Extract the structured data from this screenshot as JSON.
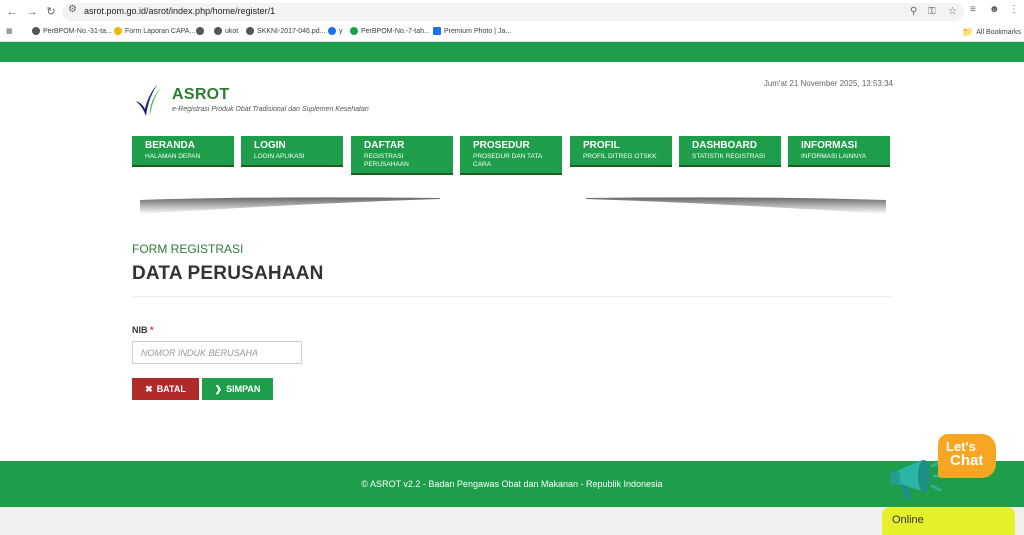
{
  "browser": {
    "url": "asrot.pom.go.id/asrot/index.php/home/register/1",
    "bookmarks": [
      "PerBPOM-No.-31-ta...",
      "Form Laporan CAPA...",
      "ukot",
      "SKKNI-2017-046.pd...",
      "y",
      "PerBPOM-No.-7-tah...",
      "Premium Photo | Ja..."
    ],
    "all_bookmarks": "All Bookmarks"
  },
  "header": {
    "title": "ASROT",
    "subtitle": "e-Registrasi Produk Obat Tradisional dan Suplemen Kesehatan",
    "datetime": "Jum'at 21 November 2025, 13:53:34"
  },
  "menu": [
    {
      "title": "BERANDA",
      "sub": "HALAMAN DEPAN"
    },
    {
      "title": "LOGIN",
      "sub": "LOGIN APLIKASI"
    },
    {
      "title": "DAFTAR",
      "sub": "REGISTRASI PERUSAHAAN"
    },
    {
      "title": "PROSEDUR",
      "sub": "PROSEDUR DAN TATA CARA"
    },
    {
      "title": "PROFIL",
      "sub": "PROFIL DITREG OTSKK"
    },
    {
      "title": "DASHBOARD",
      "sub": "STATISTIK REGISTRASI"
    },
    {
      "title": "INFORMASI",
      "sub": "INFORMASI LAINNYA"
    }
  ],
  "form": {
    "label": "FORM REGISTRASI",
    "heading": "DATA PERUSAHAAN",
    "nib_label": "NIB",
    "nib_required": "*",
    "nib_placeholder": "NOMOR INDUK BERUSAHA",
    "nib_value": "",
    "cancel_label": "BATAL",
    "save_label": "SIMPAN"
  },
  "footer": {
    "text": "© ASROT v2.2 - Badan Pengawas Obat dan Makanan - Republik Indonesia"
  },
  "chat": {
    "line1": "Let's",
    "line2": "Chat",
    "status": "Online"
  },
  "colors": {
    "primary_green": "#1e9e4a",
    "danger_red": "#b02a2a",
    "chat_orange": "#f6a623",
    "online_yellow": "#e5ef2a"
  }
}
